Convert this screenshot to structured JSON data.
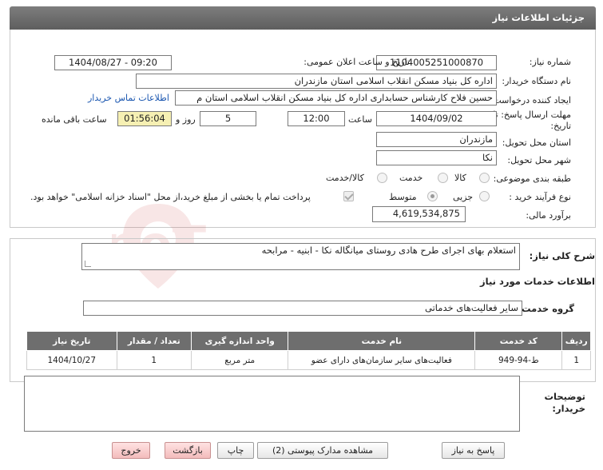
{
  "panel": {
    "title": "جزئیات اطلاعات نیاز"
  },
  "fields": {
    "need_number_label": "شماره نیاز:",
    "need_number": "1104005251000870",
    "announce_label": "تاریخ و ساعت اعلان عمومی:",
    "announce_value": "1404/08/27 - 09:20",
    "buyer_org_label": "نام دستگاه خریدار:",
    "buyer_org": "اداره کل بنیاد مسکن انقلاب اسلامی استان مازندران",
    "requester_label": "ایجاد کننده درخواست:",
    "requester": "حسین فلاح کارشناس حسابداری اداره کل بنیاد مسکن انقلاب اسلامی استان م",
    "contact_link": "اطلاعات تماس خریدار",
    "deadline_label_1": "مهلت ارسال پاسخ: تا",
    "deadline_label_2": "تاریخ:",
    "deadline_date": "1404/09/02",
    "time_label": "ساعت",
    "deadline_time": "12:00",
    "days_value": "5",
    "days_label": "روز و",
    "remaining_time": "01:56:04",
    "remaining_label": "ساعت باقی مانده",
    "province_label": "استان محل تحویل:",
    "province": "مازندران",
    "city_label": "شهر محل تحویل:",
    "city": "نکا",
    "category_label": "طبقه بندی موضوعی:",
    "category_options": [
      "کالا",
      "خدمت",
      "کالا/خدمت"
    ],
    "process_label": "نوع فرآیند خرید :",
    "process_options": [
      "جزیی",
      "متوسط"
    ],
    "payment_note": "پرداخت تمام یا بخشی از مبلغ خرید،از محل \"اسناد خزانه اسلامی\" خواهد بود.",
    "budget_label": "برآورد مالی:",
    "budget": "4,619,534,875"
  },
  "description": {
    "label": "شرح کلی نیاز:",
    "value": "استعلام بهای اجرای طرح هادی روستای  میانگاله  نکا - ابنیه - مرابحه"
  },
  "services": {
    "section_title": "اطلاعات خدمات مورد نیاز",
    "group_label": "گروه خدمت:",
    "group_value": "سایر فعالیت‌های خدماتی",
    "columns": [
      "ردیف",
      "کد خدمت",
      "نام خدمت",
      "واحد اندازه گیری",
      "تعداد / مقدار",
      "تاریخ نیاز"
    ],
    "rows": [
      [
        "1",
        "ط-94-949",
        "فعالیت‌های سایر سازمان‌های دارای عضو",
        "متر مربع",
        "1",
        "1404/10/27"
      ]
    ]
  },
  "buyer_notes": {
    "label_1": "توضیحات",
    "label_2": "خریدار:",
    "value": ""
  },
  "buttons": {
    "reply": "پاسخ به نیاز",
    "attachments": "مشاهده مدارک پیوستی (2)",
    "print": "چاپ",
    "back": "بازگشت",
    "exit": "خروج"
  },
  "watermark": {
    "text": "AriaTender.neT"
  },
  "colors": {
    "header": "#6e6e6e",
    "link": "#1a56b0",
    "remaining_bg": "#f6f0b3",
    "exit_bg": "#f3bcbc"
  }
}
